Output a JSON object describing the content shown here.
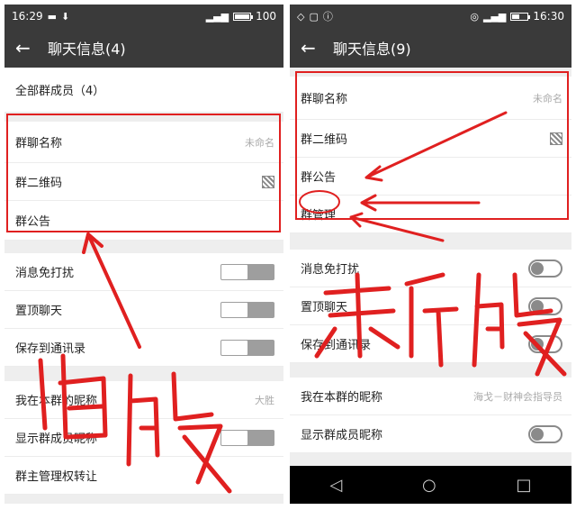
{
  "accent_red": "#e02020",
  "old": {
    "status": {
      "time": "16:29",
      "battery": "100",
      "battery_level": 1.0
    },
    "title": "聊天信息(4)",
    "members": "全部群成员（4）",
    "group_name_label": "群聊名称",
    "group_name_value": "未命名",
    "qr_label": "群二维码",
    "notice_label": "群公告",
    "mute_label": "消息免打扰",
    "pin_label": "置顶聊天",
    "save_label": "保存到通讯录",
    "nickname_label": "我在本群的昵称",
    "nickname_value": "大胜",
    "show_nick_label": "显示群成员昵称",
    "transfer_label": "群主管理权转让",
    "handwriting": "旧版"
  },
  "new": {
    "status": {
      "time": "16:30",
      "battery_level": 0.5
    },
    "title": "聊天信息(9)",
    "group_name_label": "群聊名称",
    "group_name_value": "未命名",
    "qr_label": "群二维码",
    "notice_label": "群公告",
    "manage_label": "群管理",
    "mute_label": "消息免打扰",
    "pin_label": "置顶聊天",
    "save_label": "保存到通讯录",
    "nickname_label": "我在本群的昵称",
    "nickname_value": "海戈－财神会指导员",
    "show_nick_label": "显示群成员昵称",
    "handwriting": "新版"
  }
}
